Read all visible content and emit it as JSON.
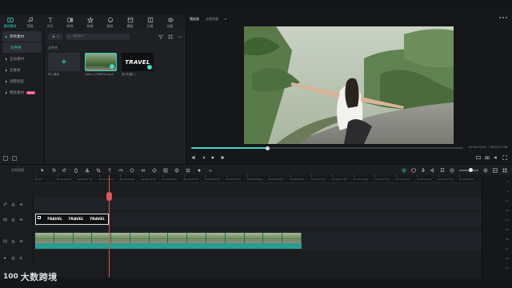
{
  "toolbar": {
    "items": [
      {
        "label": "我的素材",
        "icon": "media-icon",
        "active": true
      },
      {
        "label": "音频",
        "icon": "music-icon",
        "active": false
      },
      {
        "label": "文字",
        "icon": "text-icon",
        "active": false
      },
      {
        "label": "转场",
        "icon": "transition-icon",
        "active": false
      },
      {
        "label": "特效",
        "icon": "effects-icon",
        "active": false
      },
      {
        "label": "贴纸",
        "icon": "sticker-icon",
        "active": false
      },
      {
        "label": "模板",
        "icon": "template-icon",
        "active": false
      },
      {
        "label": "分屏",
        "icon": "split-icon",
        "active": false
      },
      {
        "label": "动画",
        "icon": "animation-icon",
        "active": false
      }
    ]
  },
  "nav": {
    "project_media": "项目素材",
    "folder": "文件夹",
    "items": [
      {
        "label": "全局素材"
      },
      {
        "label": "云素材"
      },
      {
        "label": "调整图层"
      },
      {
        "label": "模板素材",
        "badge": "NEW"
      }
    ]
  },
  "media": {
    "search_placeholder": "搜索素材",
    "folder_label": "文件夹",
    "thumbs": [
      {
        "caption": "导入媒体"
      },
      {
        "caption": "video_1766946.mp4"
      },
      {
        "caption": "旅行标题 1",
        "text": "TRAVEL"
      }
    ]
  },
  "player": {
    "tabs": [
      "播放器",
      "全屏质量"
    ],
    "current_time": "00:00:03:24",
    "total_time": "00:00:17:08",
    "progress": 0.28
  },
  "timeline": {
    "label": "主时间线",
    "ruler": [
      "00:00",
      "00:00:00:20",
      "00:00:01:15",
      "00:00:02:10",
      "00:00:03:05",
      "00:00:04:00",
      "00:00:04:20",
      "00:00:05:15",
      "00:00:06:10",
      "00:00:07:05",
      "00:00:08:00",
      "00:00:08:20",
      "00:00:09:15",
      "00:00:10:10",
      "00:00:11:05",
      "00:00:12:00",
      "00:00:12:20",
      "00:00:13:15",
      "00:00:14:10",
      "00:00:15:05",
      "00:00:16:00"
    ],
    "title_clip": {
      "labels": [
        "TRAVEL",
        "TRAVEL",
        "TRAVEL"
      ]
    },
    "meter": [
      "0",
      "-6",
      "-12",
      "-18",
      "-24",
      "-30",
      "-36",
      "-42",
      "-48",
      "-54"
    ]
  },
  "watermark": {
    "logo": "100",
    "text": "大数跨境"
  }
}
